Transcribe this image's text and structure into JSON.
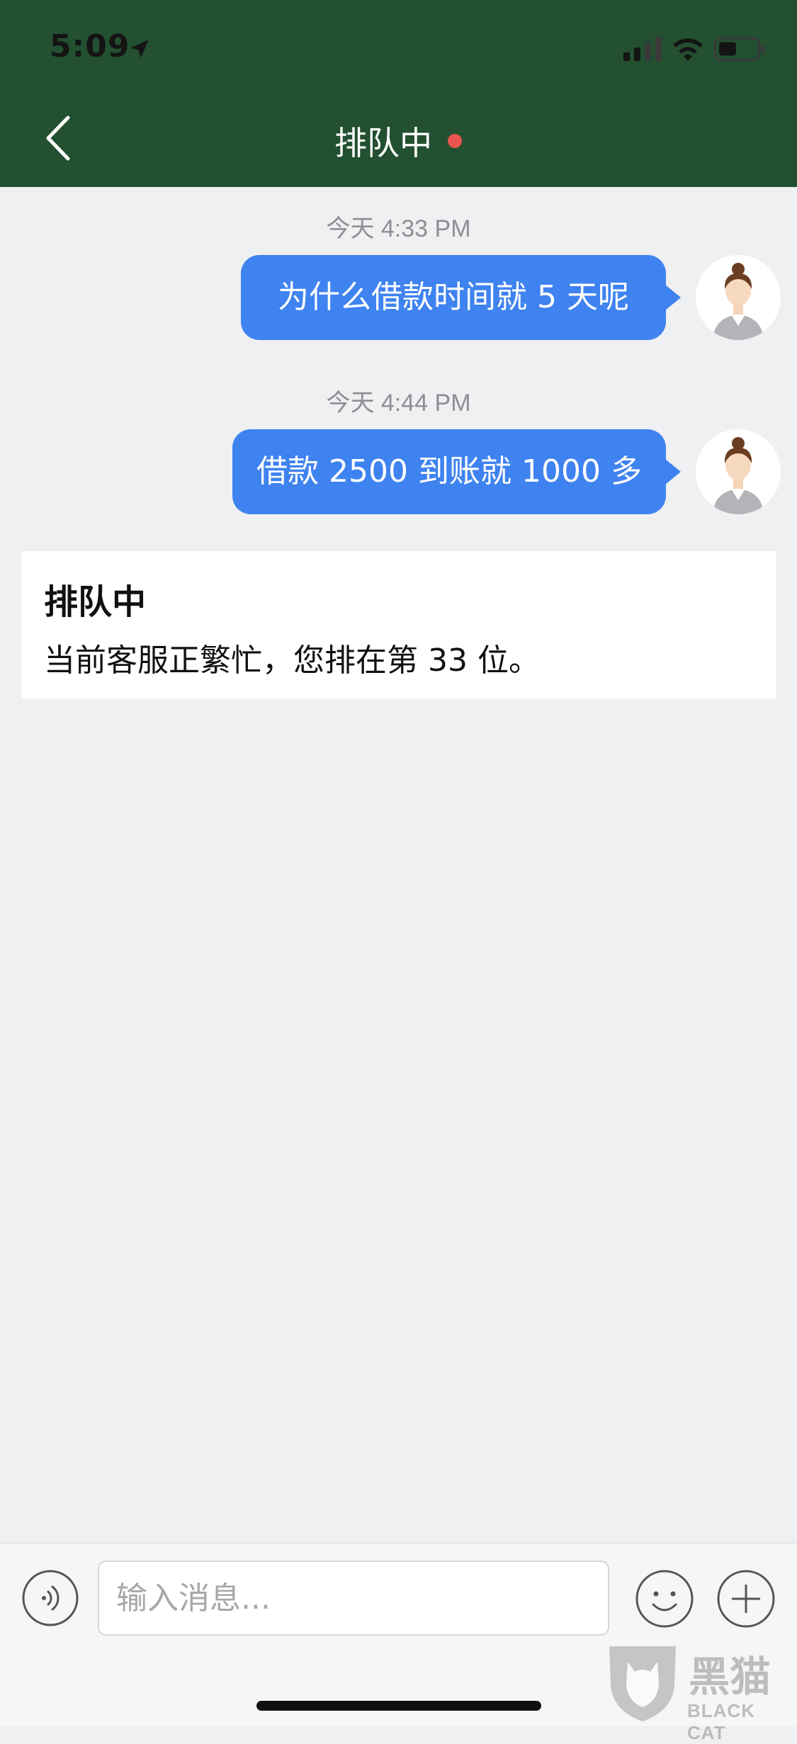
{
  "status_bar": {
    "time": "5:09"
  },
  "nav": {
    "title": "排队中"
  },
  "messages": [
    {
      "timestamp": "今天 4:33 PM",
      "text": "为什么借款时间就 5 天呢"
    },
    {
      "timestamp": "今天 4:44 PM",
      "text": "借款 2500 到账就 1000 多"
    }
  ],
  "notice": {
    "title": "排队中",
    "body": "当前客服正繁忙，您排在第 33 位。"
  },
  "composer": {
    "placeholder": "输入消息..."
  },
  "watermark": {
    "cn": "黑猫",
    "en": "BLACK CAT"
  },
  "colors": {
    "header_bg": "#235030",
    "bubble_bg": "#3f83f0",
    "chat_bg": "#eff0f2",
    "status_dot": "#e8554f"
  },
  "icons": [
    "location-arrow-icon",
    "signal-icon",
    "wifi-icon",
    "battery-icon",
    "back-chevron-icon",
    "voice-icon",
    "emoji-icon",
    "plus-icon",
    "avatar-icon"
  ]
}
